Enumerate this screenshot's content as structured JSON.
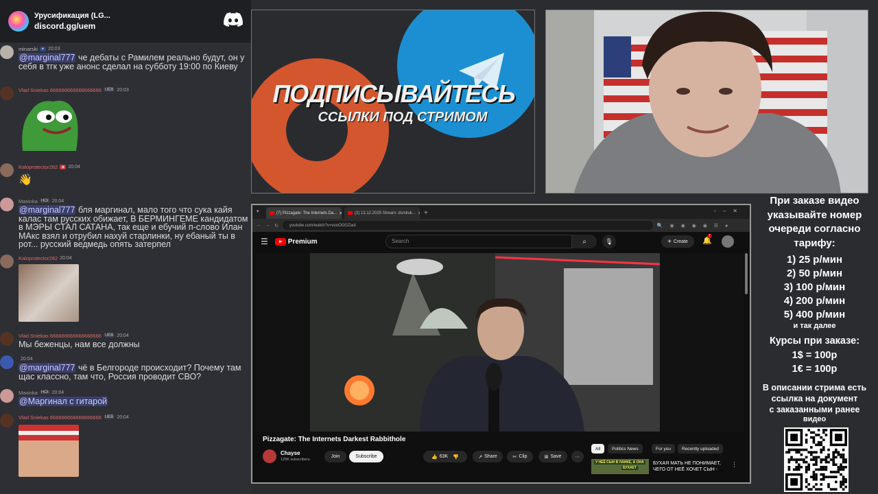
{
  "server": {
    "name": "Урусификация (LG...",
    "invite": "discord.gg/uem"
  },
  "messages": [
    {
      "user": "minarski",
      "time": "20:03",
      "mention": "@marginal777",
      "text": " че дебаты с Рамилем реально будут, он у себя в тгк уже анонс сделал на субботу 19:00 по Киеву"
    },
    {
      "user": "Vlad Sniekas 666666666666666666",
      "badge": "UEB",
      "time": "20:03",
      "text": ""
    },
    {
      "user": "Kaloprotector282",
      "time": "20:04",
      "text": ""
    },
    {
      "user": "Maxinka",
      "badge": "HOI",
      "time": "20:04",
      "mention": "@marginal777",
      "text": " бля маргинал, мало того что сука кайя калас там русских обижает, В БЕРМИНГЕМЕ кандидатом в МЭРЫ СТАЛ САТАНА, так еще и ебучий п-слово Илан МАкс взял и отрубил нахуй старлинки, ну ебаный ты в рот... русский ведмедь опять затерпел"
    },
    {
      "user": "Kaloprotector282",
      "time": "20:04",
      "text": ""
    },
    {
      "user": "Vlad Sniekas 666666666666666666",
      "badge": "UEB",
      "time": "20:04",
      "text": "Мы беженцы, нам все должны"
    },
    {
      "user": "",
      "time": "20:04",
      "mention": "@marginal777",
      "text": " чё в Белгороде происходит? Почему там щас классно, там что, Россия проводит СВО?"
    },
    {
      "user": "Maxinka",
      "badge": "HOI",
      "time": "20:04",
      "mention": "@Маргинал с гитарой",
      "text": ""
    },
    {
      "user": "Vlad Sniekas 666666666666666666",
      "badge": "UEB",
      "time": "20:04",
      "text": ""
    }
  ],
  "promo": {
    "line1": "ПОДПИСЫВАЙТЕСЬ",
    "line2": "ССЫЛКИ ПОД СТРИМОМ"
  },
  "browser": {
    "tabs": [
      "(7) Pizzagate: The Internets Da...",
      "(2) 13.12.2025 Stream: dsmituk..."
    ],
    "url": "youtube.com/watch?v=vooOOGZaol",
    "brand": "Premium",
    "search_placeholder": "Search",
    "create_label": "Create",
    "notif_count": "7"
  },
  "video": {
    "title": "Pizzagate: The Internets Darkest Rabbithole",
    "channel": "Chayse",
    "subscribers": "125K subscribers",
    "join": "Join",
    "subscribe": "Subscribe",
    "likes": "63K",
    "share": "Share",
    "clip": "Clip",
    "save": "Save"
  },
  "chips": [
    "All",
    "Politics News",
    "For you",
    "Recently uploaded"
  ],
  "recommended": {
    "thumb_text_1": "У НЕЁ СЫН В ЛАНКЕ, А ОНА",
    "thumb_text_2": "БУХАЕТ",
    "title": "БУХАЯ МАТЬ НЕ ПОНИМАЕТ, ЧЕГО ОТ НЕЁ ХОЧЕТ СЫН -"
  },
  "info": {
    "l1": "При заказе видео",
    "l2": "указывайте номер",
    "l3": "очереди согласно",
    "l4": "тарифу:",
    "tariffs": [
      "1) 25 р/мин",
      "2) 50 р/мин",
      "3) 100 р/мин",
      "4) 200 р/мин",
      "5) 400 р/мин"
    ],
    "etc": "и так далее",
    "rates_title": "Курсы при заказе:",
    "rates": [
      "1$ = 100р",
      "1€ = 100р"
    ],
    "desc1": "В описании стрима есть",
    "desc2": "ссылка на документ",
    "desc3": "с заказанными ранее",
    "desc4": "видео"
  },
  "colors": {
    "discord_bg": "#2e2f34",
    "mention": "#c9cdfb",
    "youtube_red": "#ff0000",
    "telegram_blue": "#1b8fd2",
    "accent_orange": "#d4562e"
  }
}
